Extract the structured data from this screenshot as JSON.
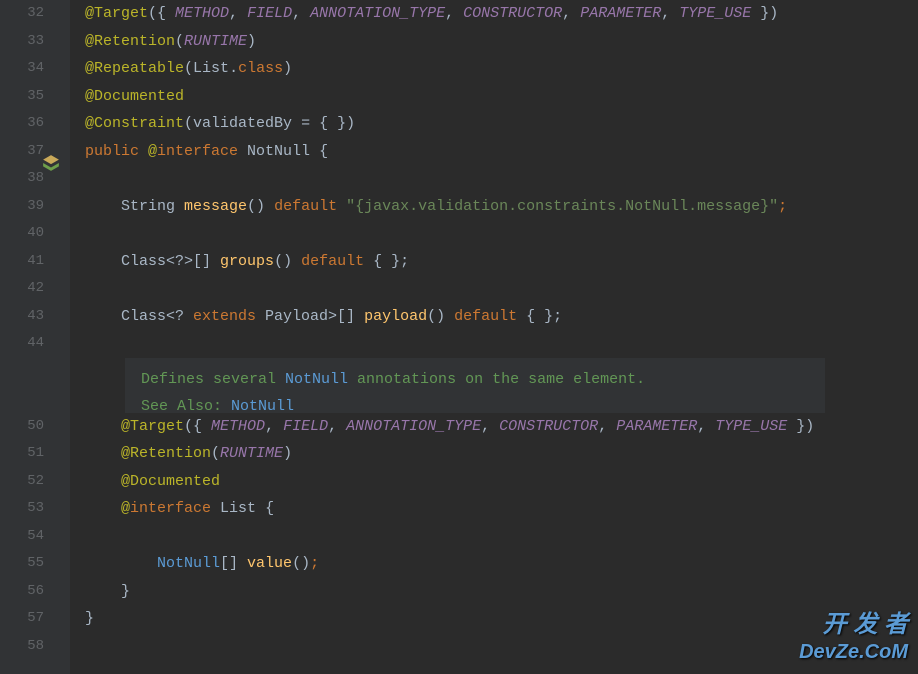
{
  "linenums": [
    "32",
    "33",
    "34",
    "35",
    "36",
    "37",
    "38",
    "39",
    "40",
    "41",
    "42",
    "43",
    "44",
    "",
    "",
    "50",
    "51",
    "52",
    "53",
    "54",
    "55",
    "56",
    "57",
    "58"
  ],
  "code": {
    "l32": {
      "at": "@Target",
      "p1": "({ ",
      "t1": "METHOD",
      "c": ", ",
      "t2": "FIELD",
      "t3": "ANNOTATION_TYPE",
      "t4": "CONSTRUCTOR",
      "t5": "PARAMETER",
      "t6": "TYPE_USE",
      "p2": " })"
    },
    "l33": {
      "at": "@Retention",
      "p1": "(",
      "t1": "RUNTIME",
      "p2": ")"
    },
    "l34": {
      "at": "@Repeatable",
      "p1": "(",
      "id": "List",
      "dot": ".",
      "kw": "class",
      "p2": ")"
    },
    "l35": {
      "at": "@Documented"
    },
    "l36": {
      "at": "@Constraint",
      "p1": "(",
      "param": "validatedBy = { }",
      "p2": ")"
    },
    "l37": {
      "kw1": "public ",
      "at": "@",
      "kw2": "interface ",
      "name": "NotNull ",
      "brace": "{"
    },
    "l39": {
      "indent": "    ",
      "type": "String ",
      "method": "message",
      "p": "() ",
      "kw": "default ",
      "str": "\"{javax.validation.constraints.NotNull.message}\"",
      "semi": ";"
    },
    "l41": {
      "indent": "    ",
      "type": "Class<?>[] ",
      "method": "groups",
      "p": "() ",
      "kw": "default ",
      "post": "{ };"
    },
    "l43": {
      "indent": "    ",
      "type1": "Class<? ",
      "kw1": "extends ",
      "type2": "Payload>[] ",
      "method": "payload",
      "p": "() ",
      "kw2": "default ",
      "post": "{ };"
    },
    "doc": {
      "t1": "Defines several ",
      "link1": "NotNull",
      "t2": " annotations on the same element.",
      "t3": "See Also: ",
      "link2": "NotNull"
    },
    "l50": {
      "indent": "    ",
      "at": "@Target",
      "p1": "({ ",
      "t1": "METHOD",
      "c": ", ",
      "t2": "FIELD",
      "t3": "ANNOTATION_TYPE",
      "t4": "CONSTRUCTOR",
      "t5": "PARAMETER",
      "t6": "TYPE_USE",
      "p2": " })"
    },
    "l51": {
      "indent": "    ",
      "at": "@Retention",
      "p1": "(",
      "t1": "RUNTIME",
      "p2": ")"
    },
    "l52": {
      "indent": "    ",
      "at": "@Documented"
    },
    "l53": {
      "indent": "    ",
      "at": "@",
      "kw": "interface ",
      "name": "List ",
      "brace": "{"
    },
    "l55": {
      "indent": "        ",
      "type": "NotNull",
      "arr": "[] ",
      "method": "value",
      "p": "()",
      "semi": ";"
    },
    "l56": {
      "indent": "    ",
      "brace": "}"
    },
    "l57": {
      "brace": "}"
    }
  },
  "watermark": {
    "line1": "开 发 者",
    "line2": "DevZe.CoM"
  }
}
